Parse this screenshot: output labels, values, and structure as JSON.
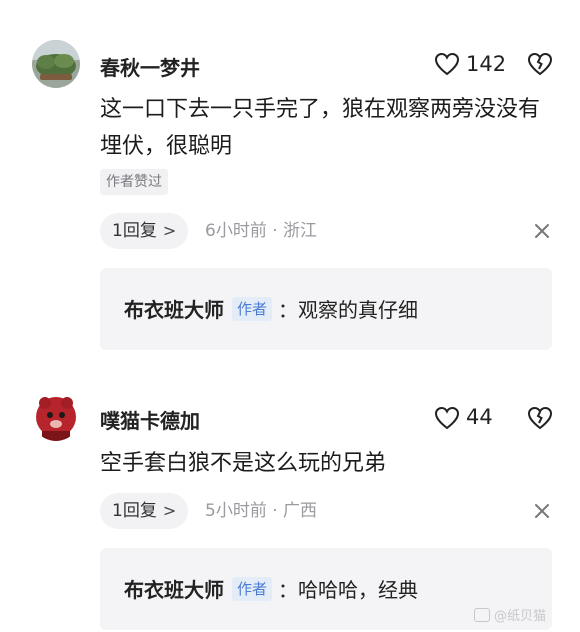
{
  "comments": [
    {
      "username": "春秋一梦井",
      "like_count": "142",
      "content": "这一口下去一只手完了，狼在观察两旁没没有埋伏，很聪明",
      "badge": "作者赞过",
      "reply_label": "1回复",
      "meta": "6小时前 · 浙江",
      "reply": {
        "author": "布衣班大师",
        "tag": "作者",
        "text": "：观察的真仔细"
      }
    },
    {
      "username": "噗猫卡德加",
      "like_count": "44",
      "content": "空手套白狼不是这么玩的兄弟",
      "reply_label": "1回复",
      "meta": "5小时前 · 广西",
      "reply": {
        "author": "布衣班大师",
        "tag": "作者",
        "text": "：哈哈哈，经典"
      }
    }
  ],
  "watermark": "@纸贝猫"
}
